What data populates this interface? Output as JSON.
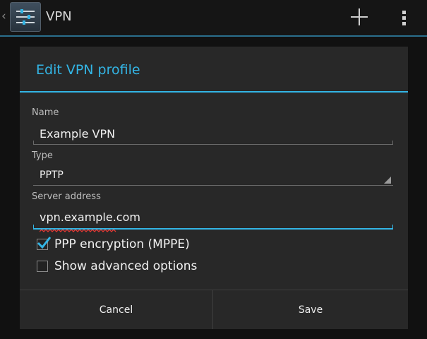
{
  "actionbar": {
    "title": "VPN",
    "icons": [
      "up-caret-icon",
      "vpn-settings-icon",
      "add-icon",
      "overflow-menu-icon"
    ]
  },
  "dialog": {
    "title": "Edit VPN profile",
    "fields": {
      "name": {
        "label": "Name",
        "value": "Example VPN"
      },
      "type": {
        "label": "Type",
        "value": "PPTP"
      },
      "server": {
        "label": "Server address",
        "value": "vpn.example.com"
      }
    },
    "checkboxes": [
      {
        "label": "PPP encryption (MPPE)",
        "checked": true
      },
      {
        "label": "Show advanced options",
        "checked": false
      }
    ],
    "buttons": {
      "cancel": "Cancel",
      "save": "Save"
    }
  },
  "colors": {
    "accent": "#33b5e5",
    "dialog_bg": "#282828",
    "actionbar_bg": "#151515"
  }
}
